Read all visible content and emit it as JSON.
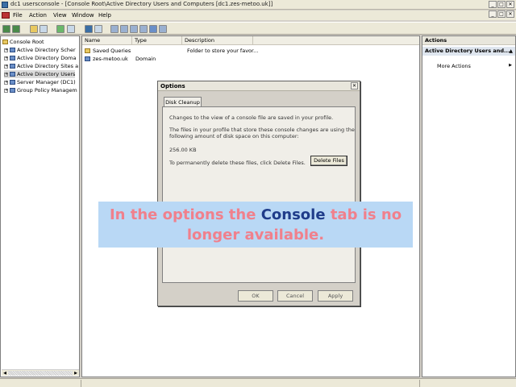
{
  "window": {
    "title": "dc1 usersconsole - [Console Root\\Active Directory Users and Computers [dc1.zes-metoo.uk]]",
    "controls": [
      "_",
      "□",
      "✕"
    ]
  },
  "menu": {
    "items": [
      "File",
      "Action",
      "View",
      "Window",
      "Help"
    ]
  },
  "tree": {
    "items": [
      {
        "label": "Console Root",
        "icon": "folder-icon"
      },
      {
        "label": "Active Directory Scher",
        "icon": "node-icon"
      },
      {
        "label": "Active Directory Doma",
        "icon": "node-icon"
      },
      {
        "label": "Active Directory Sites a",
        "icon": "node-icon"
      },
      {
        "label": "Active Directory Users",
        "icon": "node-icon"
      },
      {
        "label": "Server Manager (DC1)",
        "icon": "node-icon"
      },
      {
        "label": "Group Policy Managem",
        "icon": "node-icon"
      }
    ]
  },
  "list": {
    "columns": [
      "Name",
      "Type",
      "Description"
    ],
    "rows": [
      {
        "name": "Saved Queries",
        "type": "",
        "description": "Folder to store your favor..."
      },
      {
        "name": "zes-metoo.uk",
        "type": "Domain",
        "description": ""
      }
    ]
  },
  "actions": {
    "header": "Actions",
    "section": "Active Directory Users and...",
    "items": [
      "More Actions"
    ]
  },
  "dialog": {
    "title": "Options",
    "close": "✕",
    "tab": "Disk Cleanup",
    "text1": "Changes to the view of a console file are saved in your profile.",
    "text2a": "The files in your profile that store these console changes are using the",
    "text2b": "following amount of disk space on this computer:",
    "size": "256.00 KB",
    "text3": "To permanently delete these files, click Delete Files.",
    "delete_label": "Delete Files",
    "ok_label": "OK",
    "cancel_label": "Cancel",
    "apply_label": "Apply"
  },
  "caption": {
    "part1": "In the options the ",
    "part2": "Console",
    "part3": " tab is no longer available."
  }
}
